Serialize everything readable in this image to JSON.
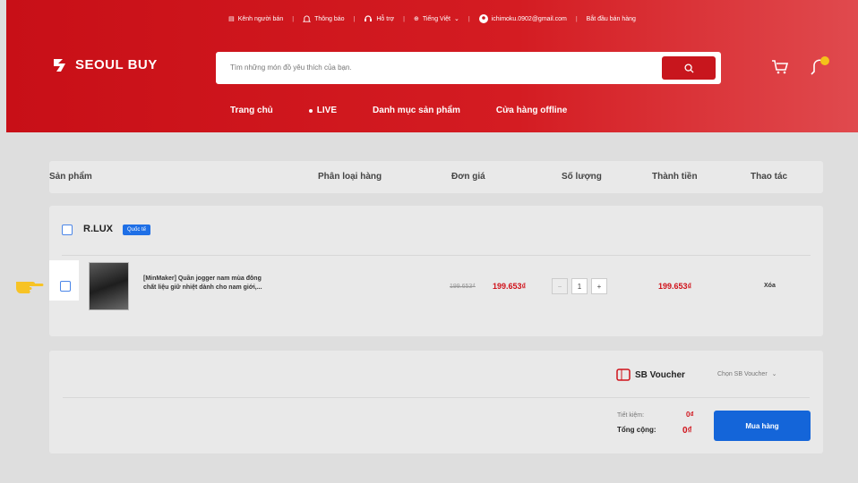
{
  "topbar": {
    "seller_channel": "Kênh người bán",
    "notifications": "Thông báo",
    "support": "Hỗ trợ",
    "language": "Tiếng Việt",
    "account_email": "ichimoku.0902@gmail.com",
    "start_selling": "Bắt đầu bán hàng"
  },
  "brand": {
    "name": "SEOUL BUY"
  },
  "search": {
    "placeholder": "Tìm những món đồ yêu thích của bạn."
  },
  "nav": {
    "home": "Trang chủ",
    "live": "LIVE",
    "categories": "Danh mục sản phẩm",
    "offline_store": "Cửa hàng offline"
  },
  "table_header": {
    "product": "Sản phẩm",
    "variant": "Phân loại hàng",
    "unit_price": "Đơn giá",
    "quantity": "Số lượng",
    "subtotal": "Thành tiền",
    "actions": "Thao tác"
  },
  "shop": {
    "name": "R.LUX",
    "badge": "Quốc tế",
    "item": {
      "name_line1": "[MinMaker] Quần jogger nam mùa đông",
      "name_line2": "chất liệu giữ nhiệt dành cho nam giới,...",
      "old_price": "199.653₫",
      "price": "199.653₫",
      "quantity": "1",
      "minus": "−",
      "plus": "+",
      "total": "199.653₫",
      "delete": "Xóa"
    }
  },
  "footer": {
    "voucher_label": "SB Voucher",
    "voucher_select": "Chọn SB Voucher",
    "savings_label": "Tiết kiệm:",
    "savings_value": "0₫",
    "total_label": "Tổng cộng:",
    "total_value": "0₫",
    "buy_button": "Mua hàng"
  },
  "colors": {
    "brand_red": "#c8161d",
    "primary_blue": "#1465d9",
    "price_red": "#d0121a"
  }
}
